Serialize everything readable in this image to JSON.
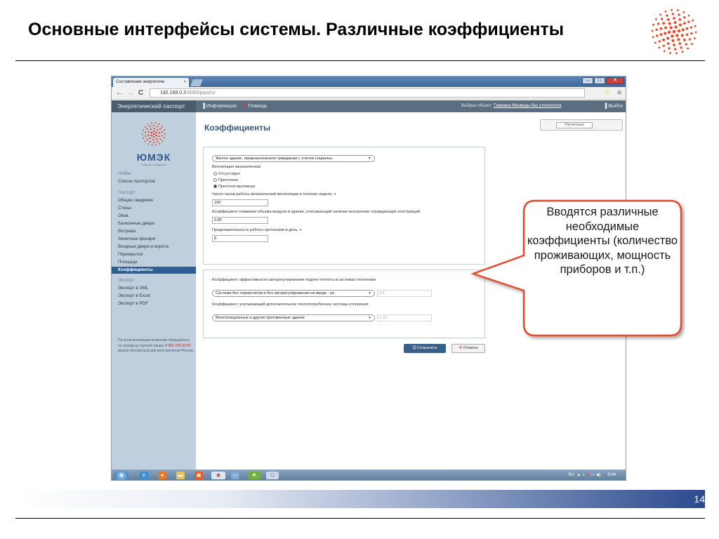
{
  "slide": {
    "title": "Основные интерфейсы системы. Различные коэффициенты",
    "page_number": "14",
    "callout": "Вводятся различные необходимые коэффициенты (количество проживающих, мощность приборов и т.п.)",
    "colors": {
      "accent_red": "#e84a2c",
      "footer_blue": "#2b4a8e"
    }
  },
  "browser": {
    "tab_title": "Составление энергетиче",
    "url_host": "192.168.0.3",
    "url_rest": ":8080/pass/ui",
    "nav_back": "←",
    "nav_forward": "→",
    "nav_reload": "C"
  },
  "app": {
    "brand": "Энергетический паспорт",
    "menu_info": "Информация",
    "menu_help": "Помощь",
    "selected_object_prefix": "Выбран объект:",
    "selected_object": "Таможня Минводы без утеплителя",
    "exit_label": "Выйти"
  },
  "sidebar": {
    "logo_text": "ЮМЭК",
    "logo_tagline": "энергия созидания",
    "lobby_header": "Лобби",
    "passport_list": "Список паспортов",
    "passport_header": "Паспорт",
    "items": [
      "Общие сведения",
      "Стены",
      "Окна",
      "Балконные двери",
      "Витражи",
      "Зенитные фонари",
      "Входные двери и ворота",
      "Перекрытия",
      "Площади"
    ],
    "active_item": "Коэффициенты",
    "export_header": "Экспорт",
    "export_items": [
      "Экспорт в XML",
      "Экспорт в Excel",
      "Экспорт в PDF"
    ],
    "note_before": "По всем возникшим вопросам обращайтесь по телефону горячей линии:",
    "note_phone": "8 800 200-99-87",
    "note_after": ", звонок бесплатный для всех регионов России."
  },
  "form": {
    "title": "Коэффициенты",
    "calc_toggle_label": "Расчетные",
    "building_type": "Жилое здание, предназначенное гражданам с учетом социальн",
    "ventilation_label": "Вентиляция механическая",
    "ventilation_options": [
      "Отсутствует",
      "Приточная",
      "Приточно-вытяжная"
    ],
    "ventilation_selected": 2,
    "hours_label": "Число часов работы механической вентиляции в течении недели, ч",
    "hours_value": "150",
    "air_coeff_label": "Коэффициент снижения объема воздуха в здании, учитывающий наличие внутренних ограждающих конструкций",
    "air_coeff_value": "0.85",
    "office_duration_label": "Продолжительность работы оргтехники в день, ч",
    "office_duration_value": "8",
    "regulation_label": "Коэффициент эффективности авторегулирования подачи теплоты в системах отопления",
    "regulation_select": "Система без термостатов и без авторегулирования на вводе - ре",
    "regulation_value": "0.5",
    "extra_heat_label": "Коэффициент, учитывающий дополнительное теплопотребление системы отопления",
    "extra_heat_select": "Многосекционные и другие протяженные здания",
    "extra_heat_value": "1.13",
    "save_label": "Сохранить",
    "cancel_label": "Отмена"
  },
  "taskbar": {
    "lang": "RU",
    "clock": "9:44"
  }
}
